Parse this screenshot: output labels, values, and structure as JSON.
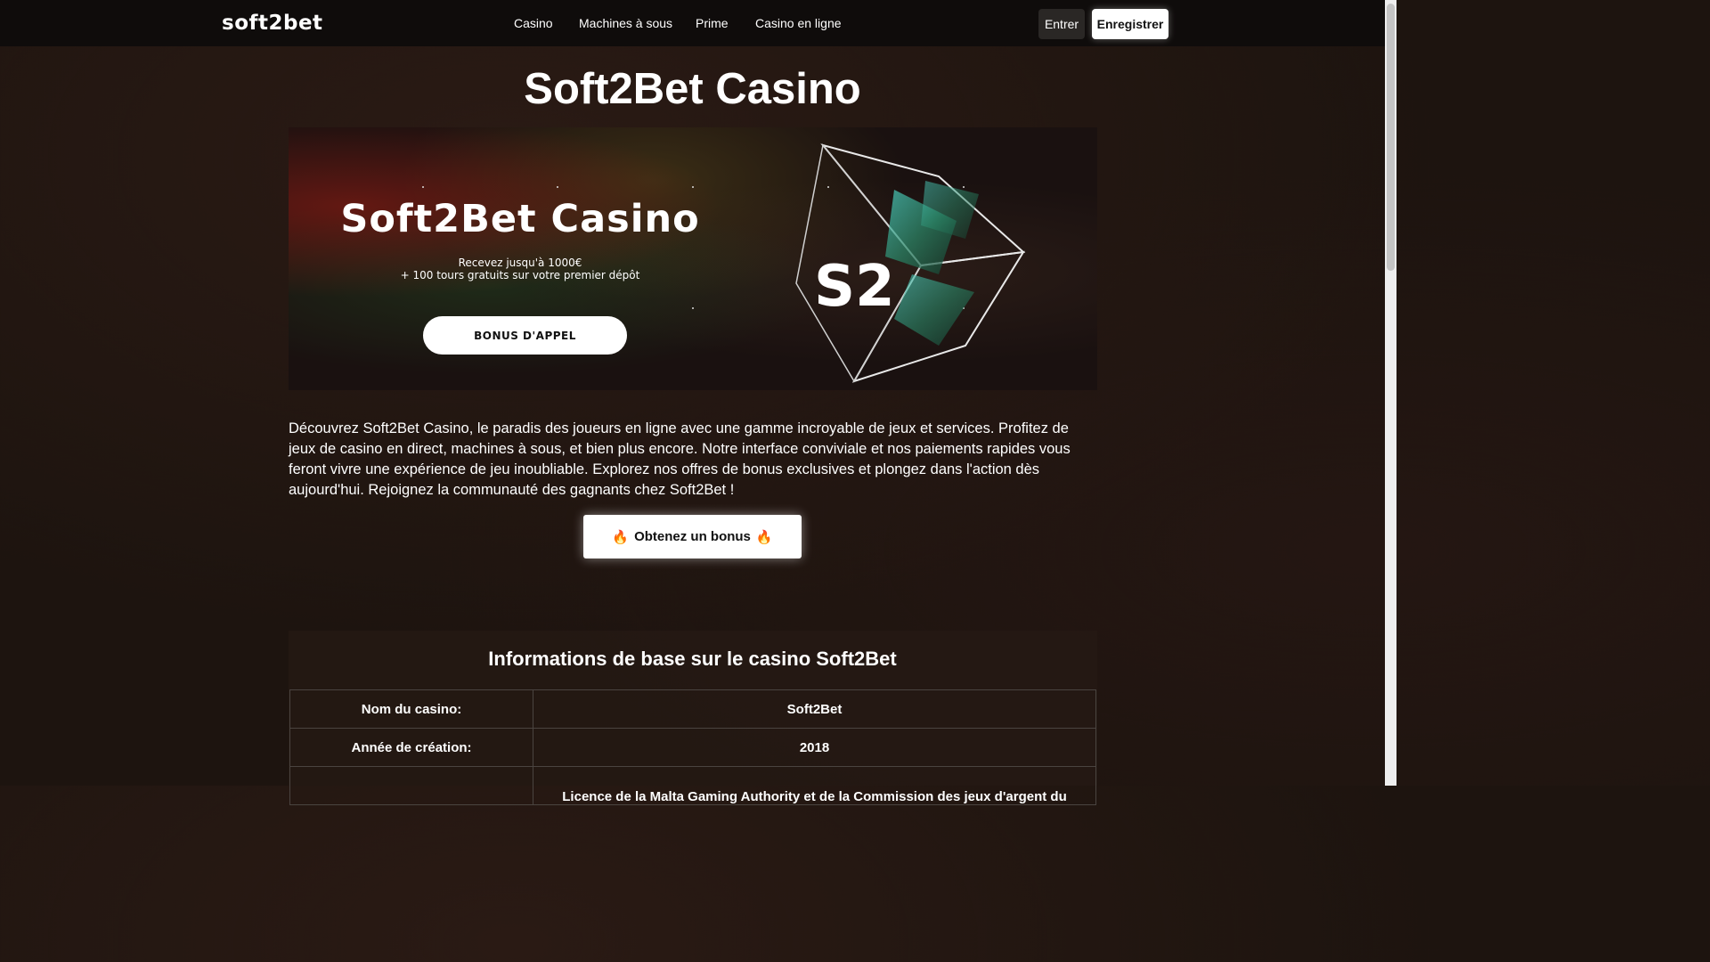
{
  "header": {
    "logo_text": "soft2bet",
    "nav": [
      {
        "label": "Casino"
      },
      {
        "label": "Machines à sous"
      },
      {
        "label": "Prime"
      },
      {
        "label": "Casino en ligne"
      }
    ],
    "login_label": "Entrer",
    "register_label": "Enregistrer"
  },
  "main": {
    "title": "Soft2Bet Casino",
    "banner": {
      "title": "Soft2Bet Casino",
      "line1": "Recevez jusqu'à 1000€",
      "line2": "+ 100 tours gratuits sur votre premier dépôt",
      "button_label": "BONUS D'APPEL",
      "art_text": "S2"
    },
    "intro": "Découvrez Soft2Bet Casino, le paradis des joueurs en ligne avec une gamme incroyable de jeux et services. Profitez de jeux de casino en direct, machines à sous, et bien plus encore. Notre interface conviviale et nos paiements rapides vous feront vivre une expérience de jeu inoubliable. Explorez nos offres de bonus exclusives et plongez dans l'action dès aujourd'hui. Rejoignez la communauté des gagnants chez Soft2Bet !",
    "cta": {
      "icon": "🔥",
      "label": "Obtenez un bonus"
    },
    "info_section": {
      "title": "Informations de base sur le casino Soft2Bet",
      "rows": [
        {
          "key": "Nom du casino:",
          "value": "Soft2Bet"
        },
        {
          "key": "Année de création:",
          "value": "2018"
        },
        {
          "key": "",
          "value": "Licence de la Malta Gaming Authority et de la Commission des jeux d'argent du"
        }
      ]
    }
  },
  "colors": {
    "background": "#1d140f",
    "topbar": "#0f0c0b",
    "button": "#ffffff"
  }
}
